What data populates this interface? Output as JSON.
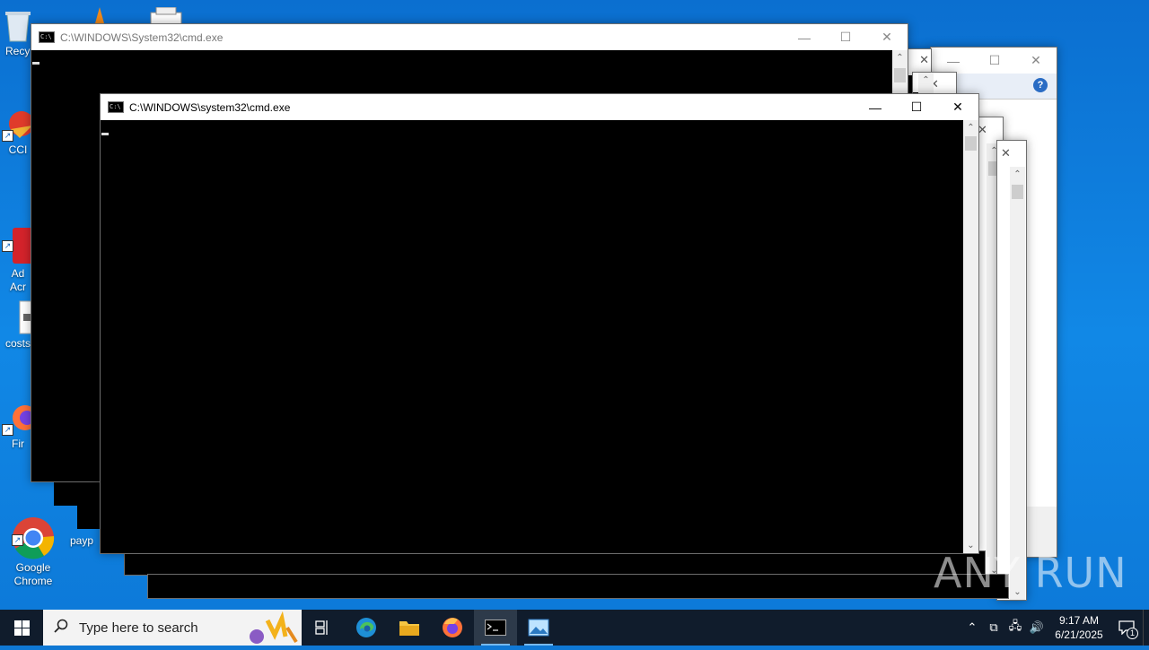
{
  "desktop_icons": [
    {
      "name": "recycle-bin-icon",
      "label": "Recy"
    },
    {
      "name": "ccleaner-icon",
      "label": "CCI"
    },
    {
      "name": "adobe-acrobat-icon",
      "label": "Ad\nAcr"
    },
    {
      "name": "costs-file-icon",
      "label": "costs"
    },
    {
      "name": "firefox-desktop-icon",
      "label": "Fir"
    },
    {
      "name": "google-chrome-icon",
      "label": "Google\nChrome"
    },
    {
      "name": "payp-file-icon",
      "label": "payp"
    }
  ],
  "windows": {
    "back_cmd": {
      "title": "C:\\WINDOWS\\System32\\cmd.exe"
    },
    "front_cmd": {
      "title": "C:\\WINDOWS\\system32\\cmd.exe"
    }
  },
  "window_controls": {
    "minimize": "—",
    "maximize": "☐",
    "close": "✕"
  },
  "taskbar": {
    "search_placeholder": "Type here to search",
    "apps": [
      {
        "name": "task-view",
        "icon": "task-view-icon"
      },
      {
        "name": "edge",
        "icon": "edge-icon"
      },
      {
        "name": "file-explorer",
        "icon": "folder-icon"
      },
      {
        "name": "firefox",
        "icon": "firefox-icon"
      },
      {
        "name": "command-prompt",
        "icon": "cmd-icon"
      },
      {
        "name": "image-viewer",
        "icon": "image-icon"
      }
    ]
  },
  "tray": {
    "time": "9:17 AM",
    "date": "6/21/2025",
    "notification_count": "1"
  },
  "watermark": "ANY RUN"
}
